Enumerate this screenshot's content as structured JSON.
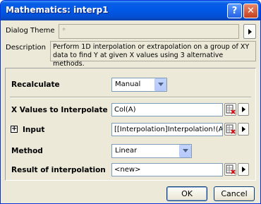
{
  "window": {
    "title": "Mathematics: interp1",
    "help_glyph": "?",
    "close_glyph": "✕"
  },
  "theme": {
    "label": "Dialog Theme",
    "value": "*"
  },
  "description": {
    "label": "Description",
    "text": "Perform 1D interpolation or extrapolation on a group of XY data to find Y at given X values using 3 alternative methods."
  },
  "form": {
    "recalculate": {
      "label": "Recalculate",
      "value": "Manual"
    },
    "x_values": {
      "label": "X Values to Interpolate",
      "value": "Col(A)"
    },
    "input": {
      "label": "Input",
      "value": "[[Interpolation]Interpolation!(A,B)",
      "expand_glyph": "+"
    },
    "method": {
      "label": "Method",
      "value": "Linear"
    },
    "result": {
      "label": "Result of interpolation",
      "value": "<new>"
    }
  },
  "buttons": {
    "ok": "OK",
    "cancel": "Cancel"
  },
  "icons": {
    "range_picker": "range-selector-icon",
    "arrow": "right-triangle-icon"
  },
  "colors": {
    "titlebar": "#0058e6",
    "dialog_bg": "#ece9d8",
    "close_button": "#c4401e"
  }
}
